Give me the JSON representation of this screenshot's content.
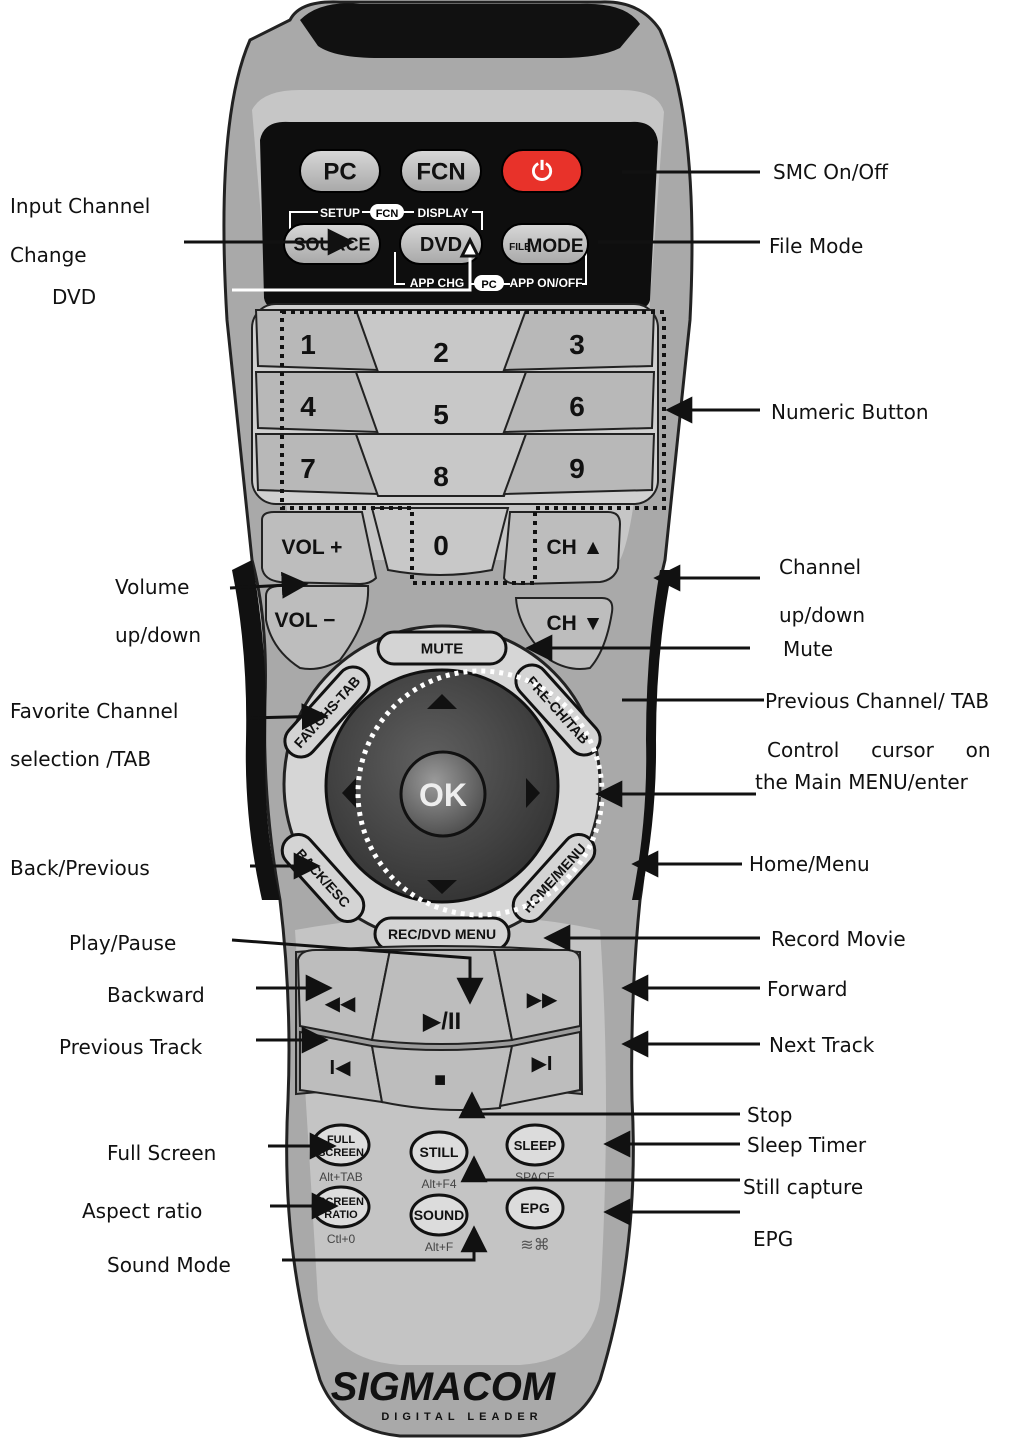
{
  "remote": {
    "top_buttons": {
      "pc": "PC",
      "fcn": "FCN",
      "power_glyph": "⏻"
    },
    "row2": {
      "source": "SOURCE",
      "dvd": "DVD",
      "file_mode_prefix": "FILE",
      "mode": "MODE"
    },
    "row2_top_labels": {
      "setup": "SETUP",
      "fcn": "FCN",
      "display": "DISPLAY"
    },
    "row2_bottom_labels": {
      "app_chg": "APP CHG",
      "pc": "PC",
      "app_onoff": "APP ON/OFF"
    },
    "numeric": [
      "1",
      "2",
      "3",
      "4",
      "5",
      "6",
      "7",
      "8",
      "9",
      "0"
    ],
    "vol_plus": "VOL +",
    "vol_minus": "VOL −",
    "ch_up": "CH ▲",
    "ch_down": "CH ▼",
    "mute": "MUTE",
    "fav_chs_tab": "FAV.CHS-TAB",
    "pre_ch_tab": "PRE-CH/TAB",
    "back_esc": "BACK/ESC",
    "home_menu": "HOME/MENU",
    "rec_dvd_menu": "REC/DVD MENU",
    "ok": "OK",
    "transport": {
      "rewind": "◀◀",
      "play_pause": "▶/II",
      "forward": "▶▶",
      "prev": "I◀",
      "stop": "■",
      "next": "▶I"
    },
    "small_buttons": {
      "full_screen": [
        "FULL",
        "SCREEN"
      ],
      "full_screen_sub": "Alt+TAB",
      "still": "STILL",
      "still_sub": "Alt+F4",
      "sleep": "SLEEP",
      "sleep_sub": "SPACE",
      "screen_ratio": [
        "SCREEN",
        "RATIO"
      ],
      "screen_ratio_sub": "Ctl+0",
      "sound": "SOUND",
      "sound_sub": "Alt+F",
      "epg": "EPG"
    },
    "brand": "SIGMACOM",
    "brand_tagline": "DIGITAL LEADER"
  },
  "annotations": {
    "smc_onoff": "SMC On/Off",
    "input_channel_1": "Input Channel",
    "input_channel_2": "Change",
    "dvd": "DVD",
    "file_mode": "File Mode",
    "numeric_button": "Numeric Button",
    "volume_1": "Volume",
    "volume_2": "up/down",
    "channel_1": "Channel",
    "channel_2": "up/down",
    "mute": "Mute",
    "favorite_1": "Favorite Channel",
    "favorite_2": "selection /TAB",
    "previous_channel": "Previous Channel/ TAB",
    "control_1": "Control     cursor     on",
    "control_2": "the Main MENU/enter",
    "back_previous": "Back/Previous",
    "home_menu": "Home/Menu",
    "play_pause": "Play/Pause",
    "record_movie": "Record Movie",
    "backward": "Backward",
    "forward": "Forward",
    "previous_track": "Previous Track",
    "next_track": "Next Track",
    "stop": "Stop",
    "full_screen": "Full Screen",
    "sleep_timer": "Sleep Timer",
    "still_capture": "Still capture",
    "aspect_ratio": "Aspect ratio",
    "epg": "EPG",
    "sound_mode": "Sound Mode"
  },
  "colors": {
    "body": "#a9a9a9",
    "body_light": "#c9c9c9",
    "panel": "#0e0e0e",
    "button": "#b4b4b4",
    "power": "#e8322a",
    "dpad": "#4a4a4a"
  }
}
